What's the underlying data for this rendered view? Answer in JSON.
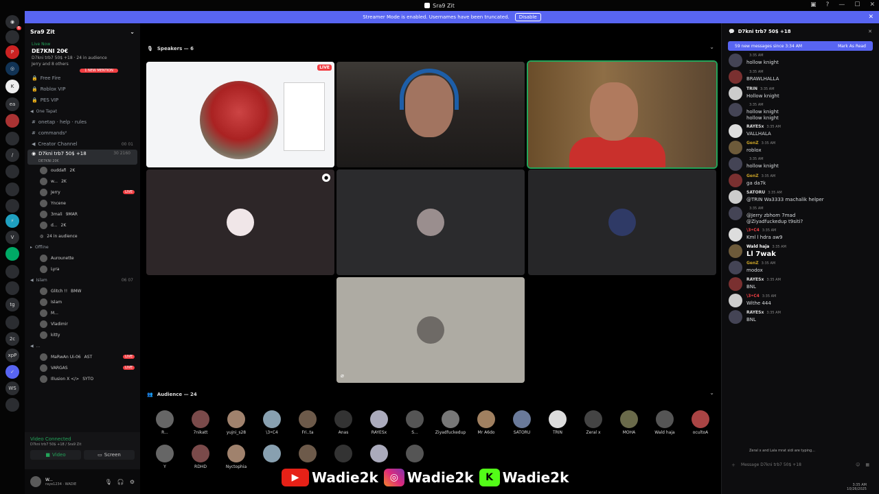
{
  "window": {
    "title": "Sra9 Zit"
  },
  "banner": {
    "text": "Streamer Mode is enabled. Usernames have been truncated.",
    "disable_label": "Disable"
  },
  "colors": {
    "accent": "#5865f2",
    "live": "#f23f43",
    "online": "#23a55a"
  },
  "sidebar": {
    "server_name": "Sra9 Zit",
    "live_card": {
      "status": "Live Now",
      "name": "DE7KNI 20€",
      "subtitle": "D7kni trb7 50$ +18 · 24 in audience",
      "sub2": "Jerry and 8 others"
    },
    "mention_badge": "1 NEW MENTION",
    "channels": [
      {
        "name": "Free Fire",
        "type": "locked"
      },
      {
        "name": "Roblox VIP",
        "type": "locked"
      },
      {
        "name": "PES VIP",
        "type": "locked"
      }
    ],
    "category1": "One Tapat",
    "channels2": [
      {
        "name": "onetap · help · rules"
      },
      {
        "name": "commands²"
      },
      {
        "name": "Creator Channel",
        "right": "00 01"
      }
    ],
    "active_channel": {
      "name": "D7kni trb7 50$ +18",
      "sub": "DE7KNI 20€",
      "right": "30 2160"
    },
    "voice_users": [
      {
        "name": "ouddafi",
        "tag": "2K"
      },
      {
        "name": "w...",
        "tag": "2K"
      },
      {
        "name": "Jerry",
        "tag": "",
        "live": "LIVE"
      },
      {
        "name": "Yncene",
        "tag": ""
      },
      {
        "name": "3mali",
        "tag": "9MAR"
      },
      {
        "name": "d...",
        "tag": "2K"
      }
    ],
    "audience_count": "24 in audience",
    "offline_label": "Offline",
    "offline_users": [
      {
        "name": "Aurounette"
      },
      {
        "name": "Lyra"
      }
    ],
    "category2": "Islam",
    "category2_right": "06 07",
    "islam_users": [
      {
        "name": "Glitch !!",
        "tag": "BMW"
      },
      {
        "name": "Islam"
      },
      {
        "name": "M..."
      },
      {
        "name": "Vladimir"
      },
      {
        "name": "kitty"
      }
    ],
    "category3": "...",
    "cat3_users": [
      {
        "name": "MaRwAn Ui-06",
        "tag": "AST",
        "live": "LIVE"
      },
      {
        "name": "VARGAS",
        "live": "LIVE"
      },
      {
        "name": "Illusion X </>",
        "tag": "SYTO"
      }
    ],
    "voice": {
      "status": "Video Connected",
      "sub": "D7kni trb7 50$ +18 / Sra9 Zit",
      "video_label": "Video",
      "screen_label": "Screen"
    },
    "user": {
      "name": "W...",
      "tag": "raye1234 · WADIE"
    }
  },
  "stage": {
    "speakers_label": "Speakers — 6",
    "live_badge": "LIVE",
    "audience_label": "Audience — 24",
    "audience_row1": [
      "R...",
      "7nikatt",
      "yujni_s28",
      "\\3•C4",
      "Fri..ta",
      "Anas",
      "RAYESx",
      "S...",
      "Ziyadfuckedup",
      "Mr A6do",
      "SATORU",
      "TRIN",
      "Zeral x",
      "MOHA",
      "Wald haja",
      "ocultoA"
    ],
    "audience_row2": [
      "Y",
      "RDHD",
      "Nyctophia",
      "",
      "",
      "",
      "",
      ""
    ]
  },
  "chat": {
    "title": "D7kni trb7 50$ +18",
    "new_messages": "59 new messages since 3:34 AM",
    "mark_read": "Mark As Read",
    "messages": [
      {
        "name": "",
        "time": "3:35 AM",
        "text": "hollow knight",
        "color": "#5865f2"
      },
      {
        "name": "",
        "time": "3:35 AM",
        "text": "BRAWLHALLA",
        "color": "#c93b3b"
      },
      {
        "name": "TRIN",
        "time": "3:35 AM",
        "text": "Hollow knight",
        "color": "#dddddd"
      },
      {
        "name": "",
        "time": "3:35 AM",
        "text": "hollow knight\nhollow knight",
        "color": "#5865f2"
      },
      {
        "name": "RAYESx",
        "time": "3:35 AM",
        "text": "VALLHALA",
        "color": "#dddddd"
      },
      {
        "name": "GenZ",
        "time": "3:35 AM",
        "text": "roblox",
        "color": "#c9a227"
      },
      {
        "name": "",
        "time": "3:35 AM",
        "text": "hollow knight",
        "color": "#5865f2"
      },
      {
        "name": "GenZ",
        "time": "3:35 AM",
        "text": "ga da7k",
        "color": "#c9a227"
      },
      {
        "name": "SATORU",
        "time": "3:35 AM",
        "text": "@TRIN Wa3333 machalik helper",
        "color": "#dddddd"
      },
      {
        "name": "",
        "time": "3:35 AM",
        "text": "@Jerry zbhom 7mad\n@Ziyadfuckedup t9siti?",
        "color": "#c93b3b"
      },
      {
        "name": "\\3•C4",
        "time": "3:35 AM",
        "text": "Kml l hdra aw9",
        "color": "#f23f43"
      },
      {
        "name": "Wald haja",
        "time": "3:35 AM",
        "text": "Ll 7wak",
        "color": "#ffffff",
        "big": true
      },
      {
        "name": "GenZ",
        "time": "3:35 AM",
        "text": "modox",
        "color": "#c9a227"
      },
      {
        "name": "RAYESx",
        "time": "3:35 AM",
        "text": "BNL",
        "color": "#dddddd"
      },
      {
        "name": "\\3•C4",
        "time": "3:35 AM",
        "text": "Withe 444",
        "color": "#f23f43"
      },
      {
        "name": "RAYESx",
        "time": "3:35 AM",
        "text": "BNL",
        "color": "#dddddd"
      }
    ],
    "typing": "Zeral x and Lala mrat sidi are typing...",
    "input_placeholder": "Message D7kni trb7 50$ +18"
  },
  "overlay": [
    {
      "platform": "youtube-icon",
      "handle": "Wadie2k",
      "color": "#e62117"
    },
    {
      "platform": "instagram-icon",
      "handle": "Wadie2k",
      "color": "#c13584"
    },
    {
      "platform": "kick-icon",
      "handle": "Wadie2k",
      "color": "#53fc18"
    }
  ],
  "clock": {
    "time": "3:35 AM",
    "date": "10/26/2025"
  }
}
